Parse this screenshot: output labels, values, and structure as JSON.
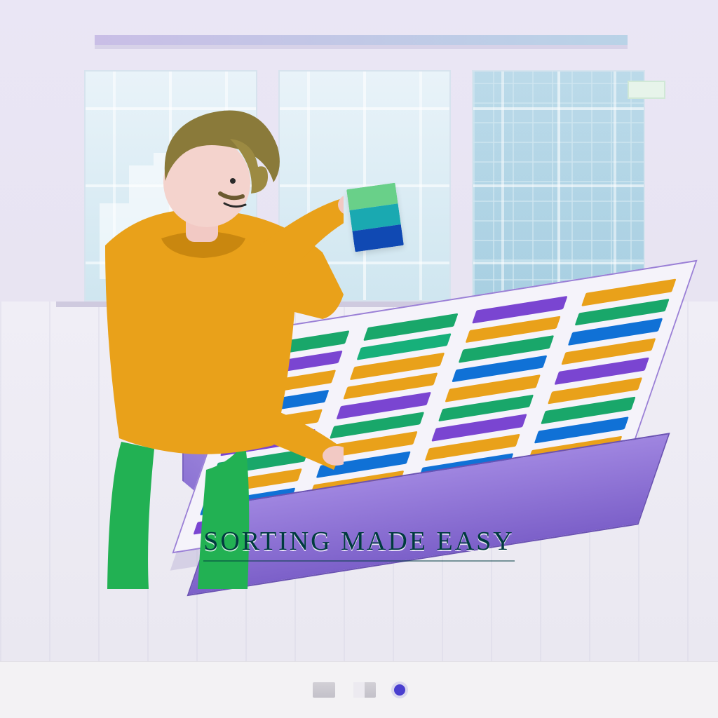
{
  "caption": "SORTING MADE EASY",
  "palette": {
    "accent_purple": "#8d74d4",
    "accent_orange": "#e9a11a",
    "accent_green": "#22b153",
    "accent_blue": "#1553c8",
    "bg_lavender": "#eae6f5",
    "text": "#003b3f"
  },
  "swatch_columns": [
    [
      "#19a76a",
      "#7a45d1",
      "#e9a11a",
      "#1071d6",
      "#e9a11a",
      "#7a45d1",
      "#19a76a",
      "#e9a11a",
      "#1071d6",
      "#7a45d1"
    ],
    [
      "#19a76a",
      "#17b07a",
      "#e9a11a",
      "#e9a11a",
      "#7a45d1",
      "#19a76a",
      "#e9a11a",
      "#1071d6",
      "#e9a11a",
      "#7a45d1"
    ],
    [
      "#7a45d1",
      "#e9a11a",
      "#19a76a",
      "#1071d6",
      "#e9a11a",
      "#19a76a",
      "#7a45d1",
      "#e9a11a",
      "#1071d6",
      "#19a76a"
    ],
    [
      "#e9a11a",
      "#19a76a",
      "#1071d6",
      "#e9a11a",
      "#7a45d1",
      "#e9a11a",
      "#19a76a",
      "#1071d6",
      "#e9a11a",
      "#7a45d1"
    ]
  ],
  "held_card_colors": [
    "#69d089",
    "#1aa9b1",
    "#1049b3"
  ],
  "carousel": {
    "total": 3,
    "active_index": 2
  }
}
